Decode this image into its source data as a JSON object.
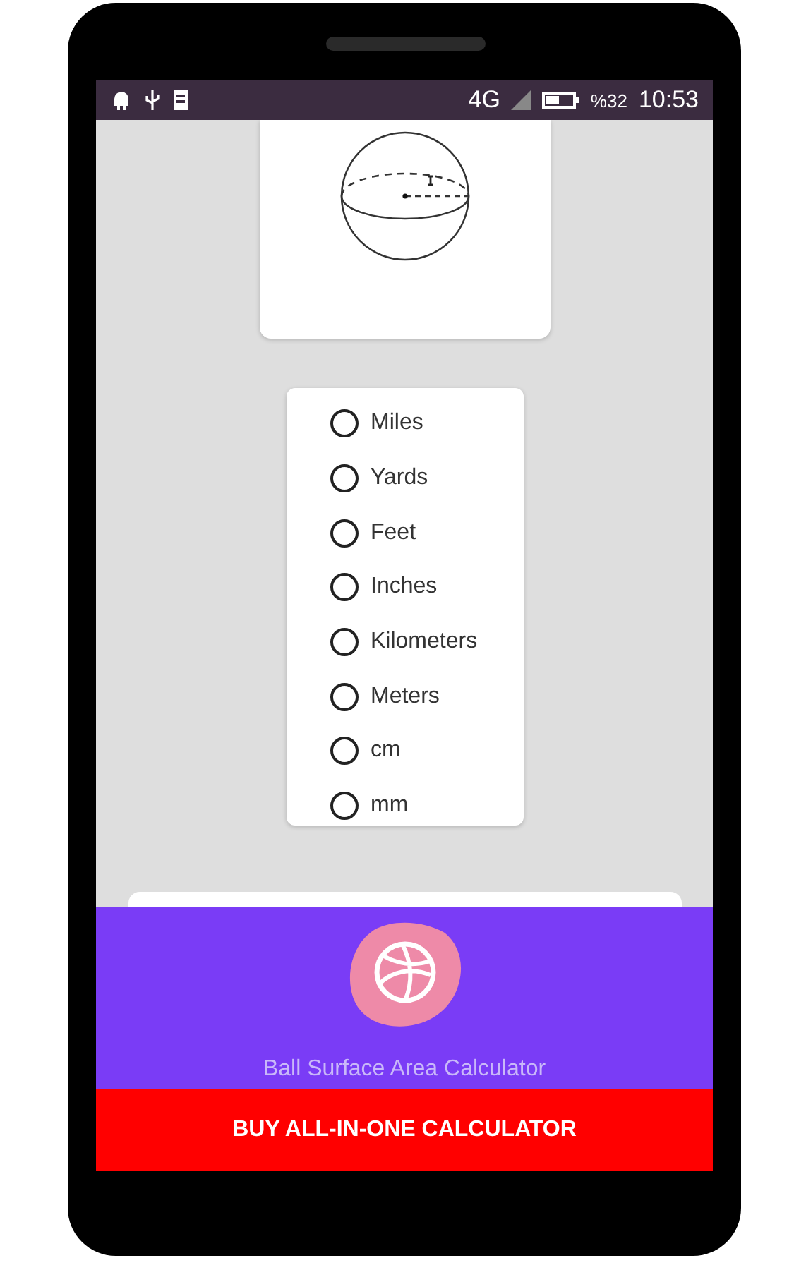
{
  "status_bar": {
    "network": "4G",
    "battery": "%32",
    "time": "10:53"
  },
  "units": [
    {
      "label": "Miles",
      "selected": false
    },
    {
      "label": "Yards",
      "selected": false
    },
    {
      "label": "Feet",
      "selected": false
    },
    {
      "label": "Inches",
      "selected": false
    },
    {
      "label": "Kilometers",
      "selected": false
    },
    {
      "label": "Meters",
      "selected": false
    },
    {
      "label": "cm",
      "selected": false
    },
    {
      "label": "mm",
      "selected": false
    }
  ],
  "app_banner": {
    "title": "Ball Surface Area Calculator"
  },
  "buy_button": {
    "label": "BUY ALL-IN-ONE CALCULATOR"
  }
}
